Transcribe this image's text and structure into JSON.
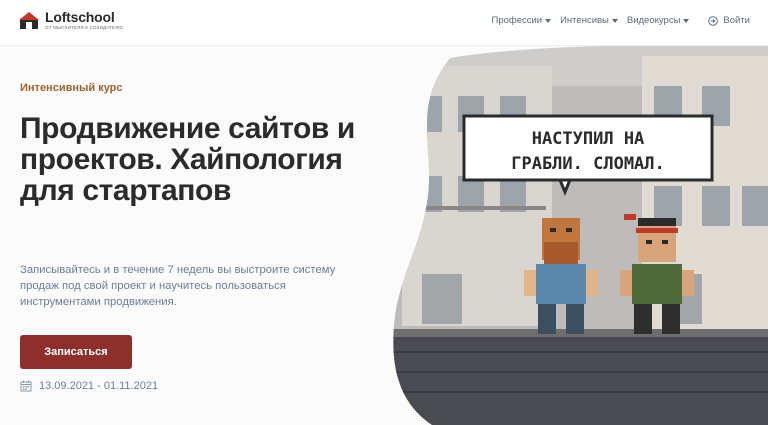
{
  "header": {
    "logo_name": "Loftschool",
    "logo_tagline": "от мыслителя к созидателю",
    "nav": [
      {
        "label": "Профессии"
      },
      {
        "label": "Интенсивы"
      },
      {
        "label": "Видеокурсы"
      }
    ],
    "login_label": "Войти"
  },
  "hero": {
    "eyebrow": "Интенсивный курс",
    "title": "Продвижение сайтов и проектов. Хайпология для стартапов",
    "description": "Записывайтесь и в течение 7 недель вы выстроите систему продаж под свой проект и научитесь пользоваться инструментами продвижения.",
    "cta_label": "Записаться",
    "dates": "13.09.2021 - 01.11.2021"
  },
  "illustration": {
    "speech_line1": "НАСТУПИЛ НА",
    "speech_line2": "ГРАБЛИ. СЛОМАЛ."
  },
  "colors": {
    "accent": "#8f2f2b",
    "eyebrow": "#a0622e",
    "text_muted": "#6d7e91"
  }
}
